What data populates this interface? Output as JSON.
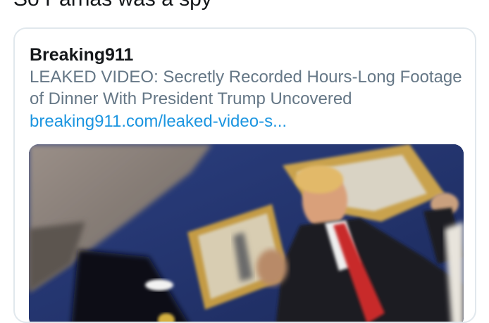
{
  "tweet": {
    "text": "So Parnas was a spy"
  },
  "card": {
    "source": "Breaking911",
    "title": "LEAKED VIDEO: Secretly Recorded Hours-Long Footage of Dinner With President Trump Uncovered",
    "link": "breaking911.com/leaked-video-s..."
  },
  "colors": {
    "text": "#14171a",
    "secondary": "#657786",
    "link": "#1b95e0",
    "border": "#e1e8ed"
  }
}
